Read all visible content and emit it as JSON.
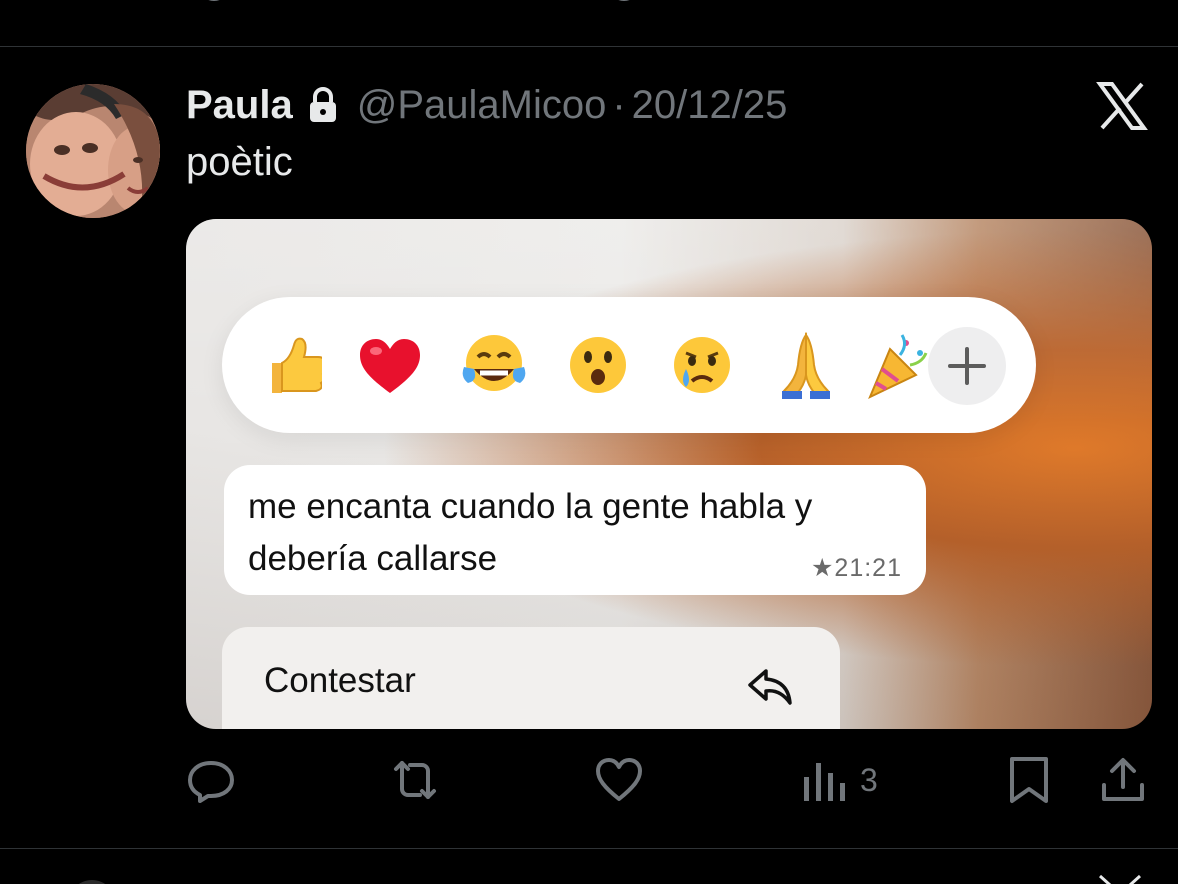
{
  "tweet": {
    "author_name": "Paula",
    "handle": "@PaulaMicoo",
    "separator": "·",
    "date": "20/12/25",
    "text": "poètic",
    "protected_icon": "lock-icon",
    "platform_logo": "x-logo-icon"
  },
  "media": {
    "reactions": [
      "👍",
      "❤️",
      "😂",
      "😮",
      "😢",
      "🙏",
      "🎉"
    ],
    "reaction_more_icon": "plus-icon",
    "message": {
      "text": "me encanta cuando la gente habla y debería callarse",
      "time": "★21:21"
    },
    "menu_item": {
      "label": "Contestar",
      "icon": "reply-arrow-icon"
    }
  },
  "actions": {
    "reply_icon": "reply-icon",
    "retweet_icon": "retweet-icon",
    "like_icon": "heart-icon",
    "views_icon": "views-icon",
    "views_count": "3",
    "bookmark_icon": "bookmark-icon",
    "share_icon": "share-icon"
  },
  "colors": {
    "background": "#000000",
    "text_primary": "#e7e9ea",
    "text_secondary": "#71767b",
    "divider": "#2f3336"
  }
}
